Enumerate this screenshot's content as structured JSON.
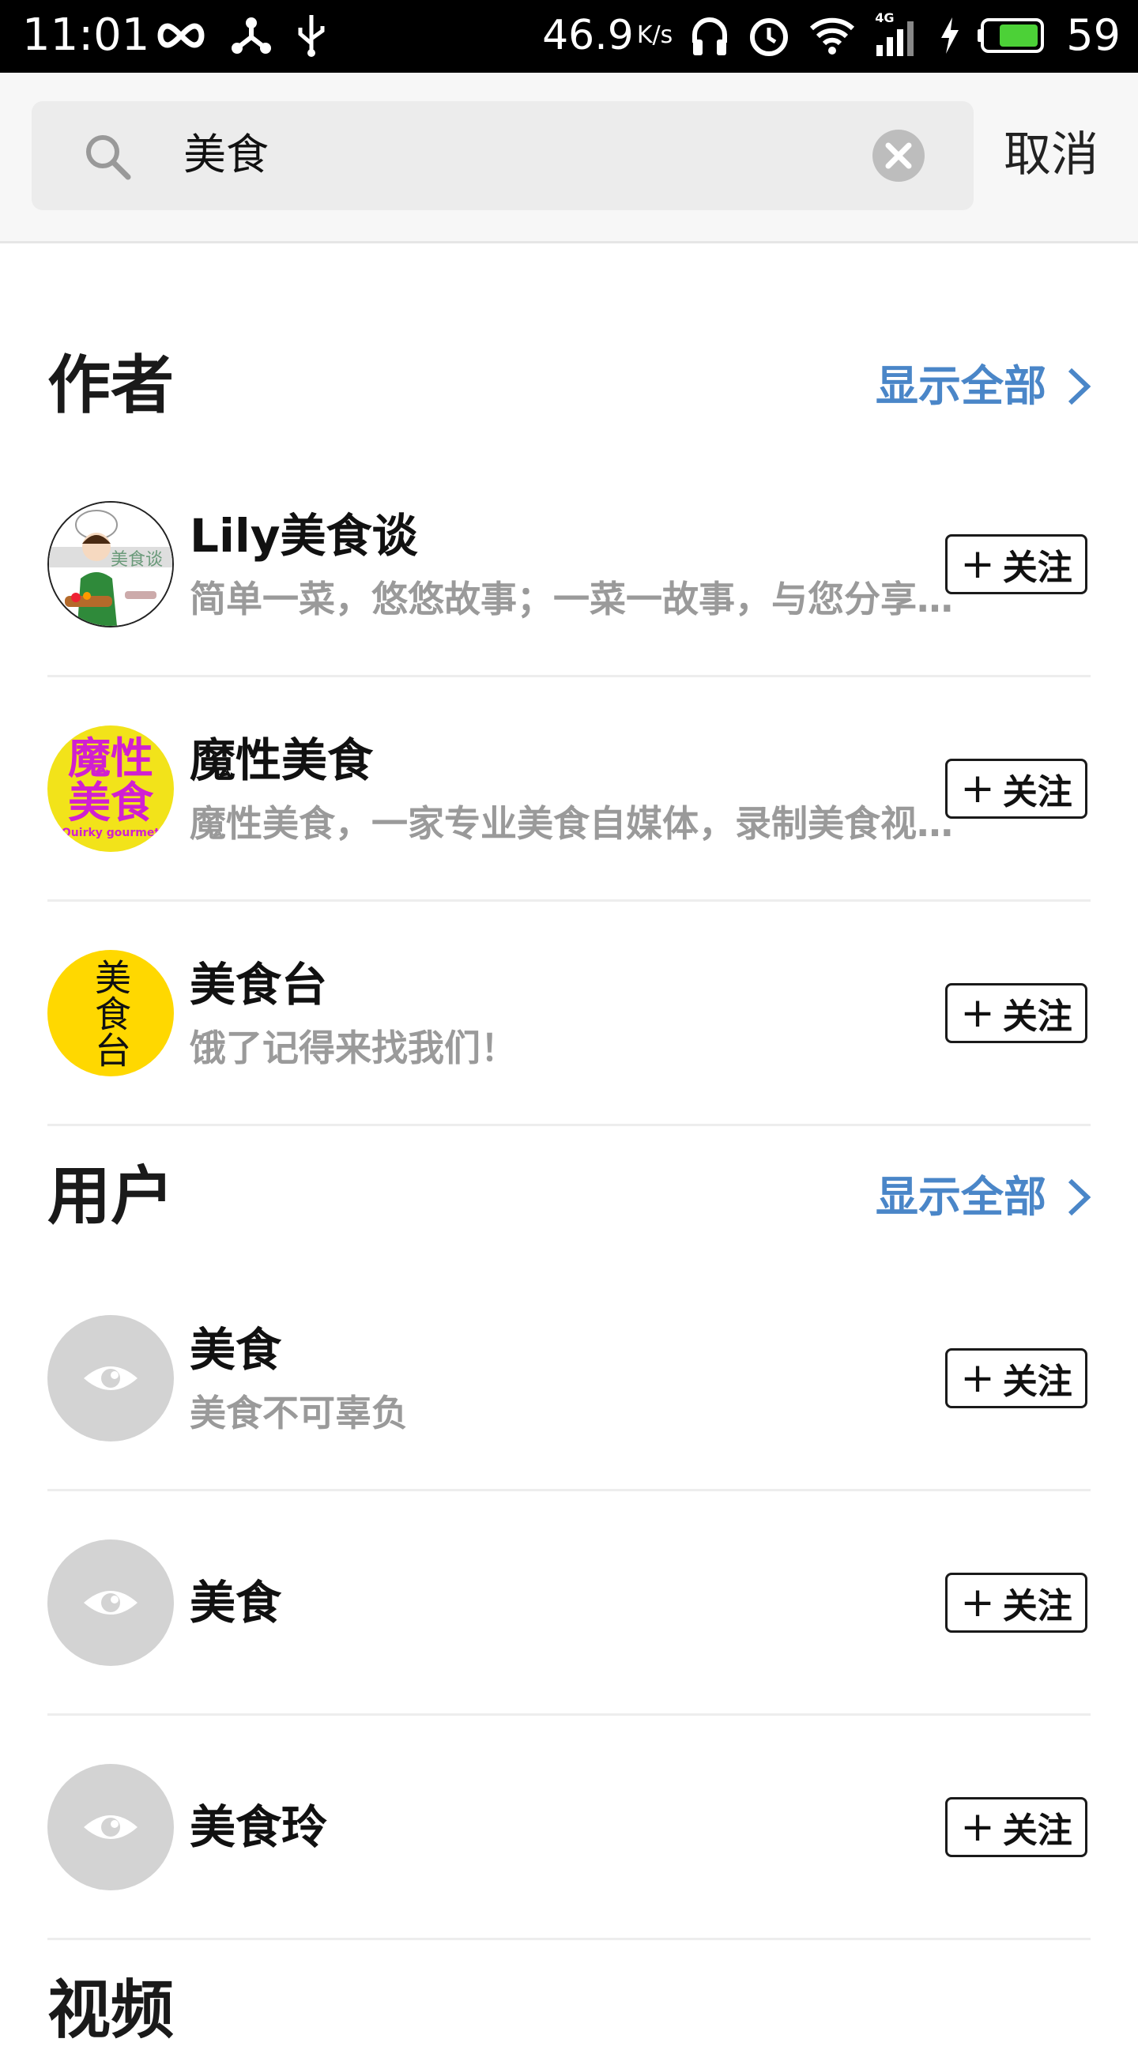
{
  "status_bar": {
    "time": "11:01",
    "speed": "46.9",
    "speed_unit": "K/s",
    "battery": "59",
    "network": "4G",
    "icons": [
      "infinity-icon",
      "share-network-icon",
      "usb-icon",
      "headphones-icon",
      "alarm-icon",
      "wifi-icon",
      "signal-icon",
      "charging-icon",
      "battery-icon"
    ]
  },
  "search": {
    "query": "美食",
    "cancel_label": "取消",
    "icons": [
      "search-icon",
      "clear-icon"
    ]
  },
  "authors_section": {
    "title": "作者",
    "show_all": "显示全部",
    "items": [
      {
        "name": "Lily美食谈",
        "desc": "简单一菜，悠悠故事；一菜一故事，与您分享美食背后的温情",
        "follow": "关注",
        "avatar_text": "美食谈"
      },
      {
        "name": "魔性美食",
        "desc": "魔性美食，一家专业美食自媒体，录制美食视频，分享美食生活",
        "follow": "关注",
        "avatar_text_line1": "魔性",
        "avatar_text_line2": "美食",
        "avatar_sub": "Quirky gourmet"
      },
      {
        "name": "美食台",
        "desc": "饿了记得来找我们！",
        "follow": "关注",
        "avatar_text": "美食台"
      }
    ]
  },
  "users_section": {
    "title": "用户",
    "show_all": "显示全部",
    "items": [
      {
        "name": "美食",
        "desc": "美食不可辜负",
        "follow": "关注"
      },
      {
        "name": "美食",
        "desc": "",
        "follow": "关注"
      },
      {
        "name": "美食玲",
        "desc": "",
        "follow": "关注"
      }
    ]
  },
  "videos_section": {
    "title": "视频"
  },
  "colors": {
    "link_blue": "#4a86c8",
    "muted_gray": "#9a9a9a",
    "avatar_yellow": "#f2e31a",
    "avatar_magenta": "#d11fd1"
  }
}
